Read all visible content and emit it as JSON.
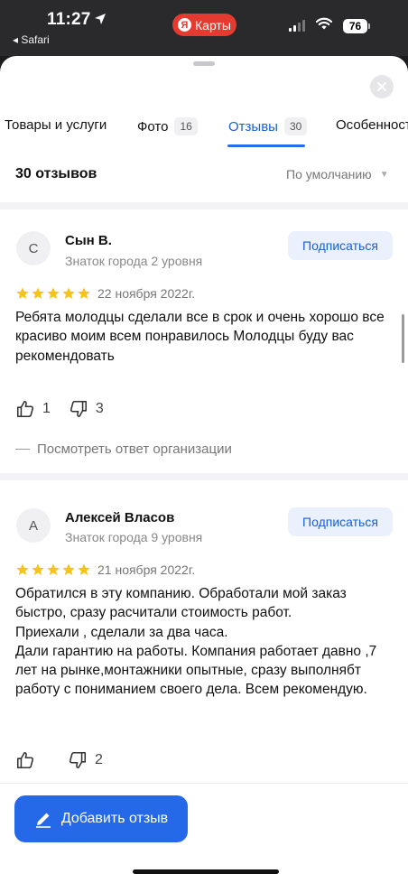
{
  "status_bar": {
    "time": "11:27",
    "back_app": "◂ Safari",
    "maps_pill_logo": "Я",
    "maps_pill_label": "Карты",
    "battery": "76"
  },
  "tabs": [
    {
      "label": "Товары и услуги",
      "count": ""
    },
    {
      "label": "Фото",
      "count": "16"
    },
    {
      "label": "Отзывы",
      "count": "30"
    },
    {
      "label": "Особенности",
      "count": ""
    }
  ],
  "reviews_header": {
    "count_label": "30 отзывов",
    "sort_label": "По умолчанию"
  },
  "reviews": [
    {
      "avatar_letter": "С",
      "author": "Сын В.",
      "level": "Знаток города 2 уровня",
      "subscribe_label": "Подписаться",
      "rating": 5,
      "date": "22 ноября 2022г.",
      "text": "Ребята молодцы сделали все в срок и очень хорошо все красиво моим всем понравилось Молодцы буду вас рекомендовать",
      "likes": "1",
      "dislikes": "3",
      "org_reply_label": "Посмотреть ответ организации"
    },
    {
      "avatar_letter": "А",
      "author": "Алексей Власов",
      "level": "Знаток города 9 уровня",
      "subscribe_label": "Подписаться",
      "rating": 5,
      "date": "21 ноября 2022г.",
      "text": "Обратился в эту компанию. Обработали мой заказ быстро, сразу расчитали стоимость работ.\nПриехали , сделали за два часа.\nДали гарантию на работы. Компания работает давно ,7 лет на рынке,монтажники опытные, сразу выполнябт работу с пониманием своего дела. Всем рекомендую.",
      "likes": "",
      "dislikes": "2"
    }
  ],
  "add_review_label": "Добавить отзыв",
  "colors": {
    "accent": "#2669e8",
    "star": "#f6c416",
    "maps_red": "#e53a2f"
  }
}
